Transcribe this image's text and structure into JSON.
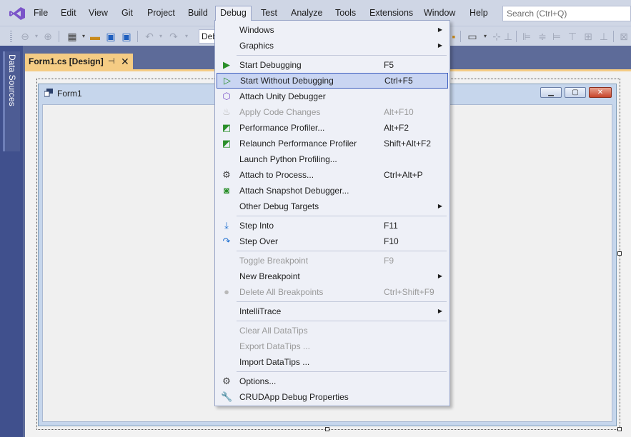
{
  "menubar": {
    "items": [
      "File",
      "Edit",
      "View",
      "Git",
      "Project",
      "Build",
      "Debug",
      "Test",
      "Analyze",
      "Tools",
      "Extensions",
      "Window",
      "Help"
    ],
    "search_placeholder": "Search (Ctrl+Q)"
  },
  "toolbar": {
    "config_combo_value": "Deb"
  },
  "side_panel": {
    "label": "Data Sources"
  },
  "document_tab": {
    "title": "Form1.cs [Design]",
    "pin_glyph": "⊣",
    "close_glyph": "✕"
  },
  "form": {
    "title": "Form1"
  },
  "debug_menu": {
    "items": [
      {
        "label": "Windows",
        "shortcut": "",
        "submenu": true,
        "enabled": true,
        "icon": ""
      },
      {
        "label": "Graphics",
        "shortcut": "",
        "submenu": true,
        "enabled": true,
        "icon": ""
      },
      {
        "label": "Start Debugging",
        "shortcut": "F5",
        "submenu": false,
        "enabled": true,
        "icon": "play-icon"
      },
      {
        "label": "Start Without Debugging",
        "shortcut": "Ctrl+F5",
        "submenu": false,
        "enabled": true,
        "icon": "play-outline-icon"
      },
      {
        "label": "Attach Unity Debugger",
        "shortcut": "",
        "submenu": false,
        "enabled": true,
        "icon": "unity-cube-icon"
      },
      {
        "label": "Apply Code Changes",
        "shortcut": "Alt+F10",
        "submenu": false,
        "enabled": false,
        "icon": "flame-icon"
      },
      {
        "label": "Performance Profiler...",
        "shortcut": "Alt+F2",
        "submenu": false,
        "enabled": true,
        "icon": "profiler-icon"
      },
      {
        "label": "Relaunch Performance Profiler",
        "shortcut": "Shift+Alt+F2",
        "submenu": false,
        "enabled": true,
        "icon": "profiler-relaunch-icon"
      },
      {
        "label": "Launch Python Profiling...",
        "shortcut": "",
        "submenu": false,
        "enabled": true,
        "icon": ""
      },
      {
        "label": "Attach to Process...",
        "shortcut": "Ctrl+Alt+P",
        "submenu": false,
        "enabled": true,
        "icon": "gears-icon"
      },
      {
        "label": "Attach Snapshot Debugger...",
        "shortcut": "",
        "submenu": false,
        "enabled": true,
        "icon": "camera-icon"
      },
      {
        "label": "Other Debug Targets",
        "shortcut": "",
        "submenu": true,
        "enabled": true,
        "icon": ""
      },
      {
        "label": "Step Into",
        "shortcut": "F11",
        "submenu": false,
        "enabled": true,
        "icon": "step-into-icon"
      },
      {
        "label": "Step Over",
        "shortcut": "F10",
        "submenu": false,
        "enabled": true,
        "icon": "step-over-icon"
      },
      {
        "label": "Toggle Breakpoint",
        "shortcut": "F9",
        "submenu": false,
        "enabled": false,
        "icon": ""
      },
      {
        "label": "New Breakpoint",
        "shortcut": "",
        "submenu": true,
        "enabled": true,
        "icon": ""
      },
      {
        "label": "Delete All Breakpoints",
        "shortcut": "Ctrl+Shift+F9",
        "submenu": false,
        "enabled": false,
        "icon": "delete-breakpoints-icon"
      },
      {
        "label": "IntelliTrace",
        "shortcut": "",
        "submenu": true,
        "enabled": true,
        "icon": ""
      },
      {
        "label": "Clear All DataTips",
        "shortcut": "",
        "submenu": false,
        "enabled": false,
        "icon": ""
      },
      {
        "label": "Export DataTips ...",
        "shortcut": "",
        "submenu": false,
        "enabled": false,
        "icon": ""
      },
      {
        "label": "Import DataTips ...",
        "shortcut": "",
        "submenu": false,
        "enabled": true,
        "icon": ""
      },
      {
        "label": "Options...",
        "shortcut": "",
        "submenu": false,
        "enabled": true,
        "icon": "gear-icon"
      },
      {
        "label": "CRUDApp Debug Properties",
        "shortcut": "",
        "submenu": false,
        "enabled": true,
        "icon": "wrench-icon"
      }
    ],
    "highlighted_index": 3
  }
}
